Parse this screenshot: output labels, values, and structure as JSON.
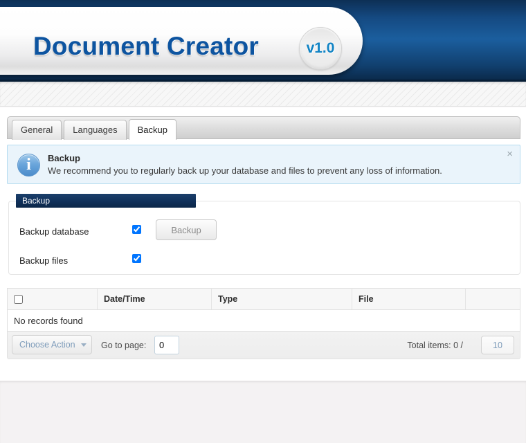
{
  "header": {
    "app_title": "Document Creator",
    "version": "v1.0"
  },
  "tabs": [
    {
      "label": "General",
      "active": false
    },
    {
      "label": "Languages",
      "active": false
    },
    {
      "label": "Backup",
      "active": true
    }
  ],
  "notice": {
    "icon": "info-icon",
    "title": "Backup",
    "message": "We recommend you to regularly back up your database and files to prevent any loss of information.",
    "close_label": "×"
  },
  "backup_panel": {
    "legend": "Backup",
    "rows": [
      {
        "label": "Backup database",
        "checked": true
      },
      {
        "label": "Backup files",
        "checked": true
      }
    ],
    "button_label": "Backup"
  },
  "records_table": {
    "columns": [
      "",
      "Date/Time",
      "Type",
      "File",
      ""
    ],
    "rows": [],
    "empty_message": "No records found"
  },
  "footer": {
    "choose_action_label": "Choose Action",
    "goto_label": "Go to page:",
    "goto_value": "0",
    "goto_placeholder": "",
    "total_items_label": "Total items: 0 /",
    "page_size_value": "10"
  },
  "colors": {
    "header_navy": "#10365f",
    "logo_blue": "#0d54a0",
    "version_blue": "#1083c4",
    "legend_navy": "#10305a",
    "notice_bg": "#eaf4fb",
    "notice_border": "#b5dcf0",
    "muted_blue": "#7e9cba"
  }
}
